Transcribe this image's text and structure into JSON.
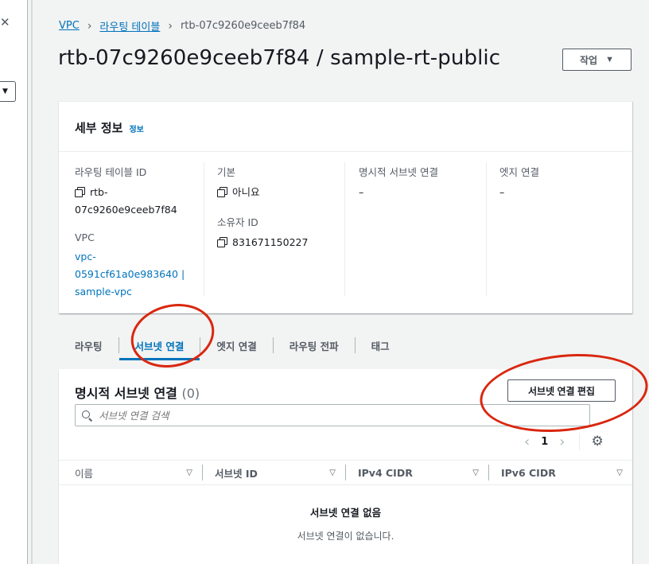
{
  "breadcrumb": {
    "root": "VPC",
    "section": "라우팅 테이블",
    "current": "rtb-07c9260e9ceeb7f84"
  },
  "page": {
    "title": "rtb-07c9260e9ceeb7f84 / sample-rt-public",
    "actions_label": "작업"
  },
  "details": {
    "heading": "세부 정보",
    "info_link": "정보",
    "route_table_id_label": "라우팅 테이블 ID",
    "route_table_id_line1": "rtb-",
    "route_table_id_line2": "07c9260e9ceeb7f84",
    "vpc_label": "VPC",
    "vpc_line1": "vpc-",
    "vpc_line2": "0591cf61a0e983640 |",
    "vpc_line3": "sample-vpc",
    "main_label": "기본",
    "main_value": "아니요",
    "owner_label": "소유자 ID",
    "owner_value": "831671150227",
    "explicit_subnet_label": "명시적 서브넷 연결",
    "explicit_subnet_value": "–",
    "edge_label": "엣지 연결",
    "edge_value": "–"
  },
  "tabs": [
    {
      "label": "라우팅",
      "active": false
    },
    {
      "label": "서브넷 연결",
      "active": true
    },
    {
      "label": "엣지 연결",
      "active": false
    },
    {
      "label": "라우팅 전파",
      "active": false
    },
    {
      "label": "태그",
      "active": false
    }
  ],
  "subnets": {
    "title": "명시적 서브넷 연결",
    "count": "(0)",
    "edit_button": "서브넷 연결 편집",
    "search_placeholder": "서브넷 연결 검색",
    "page_number": "1",
    "columns": [
      "이름",
      "서브넷 ID",
      "IPv4 CIDR",
      "IPv6 CIDR"
    ],
    "empty_title": "서브넷 연결 없음",
    "empty_desc": "서브넷 연결이 없습니다."
  },
  "left_panel": {
    "close_glyph": "✕",
    "select_glyph": "▼"
  },
  "icons": {
    "actions_caret": "▼",
    "sort": "▽",
    "prev": "‹",
    "next": "›",
    "settings": "⚙"
  },
  "colors": {
    "link": "#0073bb",
    "annotation": "#d9270f"
  }
}
